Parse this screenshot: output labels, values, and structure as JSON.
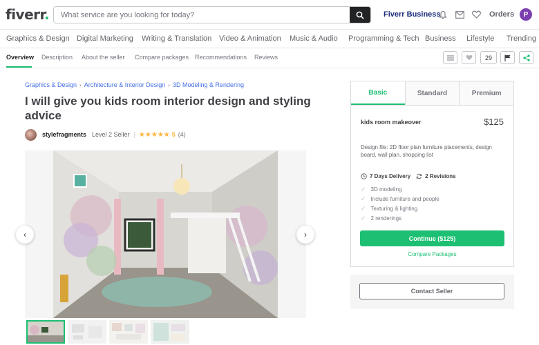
{
  "header": {
    "logo": "fiverr",
    "logo_dot": ".",
    "search_placeholder": "What service are you looking for today?",
    "fiverr_business": "Fiverr Business",
    "orders": "Orders",
    "avatar_initial": "P"
  },
  "categories": [
    "Graphics & Design",
    "Digital Marketing",
    "Writing & Translation",
    "Video & Animation",
    "Music & Audio",
    "Programming & Tech",
    "Business",
    "Lifestyle",
    "Trending"
  ],
  "tabs": [
    "Overview",
    "Description",
    "About the seller",
    "Compare packages",
    "Recommendations",
    "Reviews"
  ],
  "toolbar": {
    "likes_count": "29"
  },
  "breadcrumb": [
    "Graphics & Design",
    "Architecture & Interior Design",
    "3D Modeling & Rendering"
  ],
  "gig": {
    "title": "I will give you kids room interior design and styling advice",
    "seller_name": "stylefragments",
    "seller_level": "Level 2 Seller",
    "stars": "★★★★★",
    "rating": "5",
    "review_count": "(4)"
  },
  "package": {
    "tabs": [
      "Basic",
      "Standard",
      "Premium"
    ],
    "name": "kids room makeover",
    "price": "$125",
    "description": "Design file: 2D floor plan furniture placements, design board, wall plan, shopping list",
    "delivery": "7 Days Delivery",
    "revisions": "2 Revisions",
    "features": [
      "3D modeling",
      "Include furniture and people",
      "Texturing & lighting",
      "2 renderings"
    ],
    "continue_label": "Continue ($125)",
    "compare_label": "Compare Packages"
  },
  "contact_label": "Contact Seller",
  "colors": {
    "brand": "#1dbf73",
    "link": "#446ee7",
    "star": "#ffb33e",
    "business": "#1a2c7a"
  }
}
